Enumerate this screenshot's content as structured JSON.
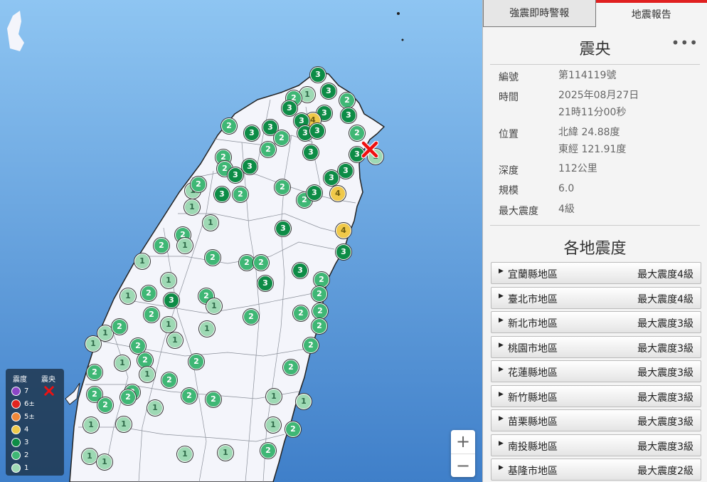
{
  "tabs": [
    {
      "label": "強震即時警報",
      "active": false
    },
    {
      "label": "地震報告",
      "active": true
    }
  ],
  "section_title": "震央",
  "more_label": "•••",
  "info": {
    "number": {
      "label": "編號",
      "value": "第114119號"
    },
    "time": {
      "label": "時間",
      "value_line1": "2025年08月27日",
      "value_line2": "21時11分00秒"
    },
    "location": {
      "label": "位置",
      "value_line1": "北緯 24.88度",
      "value_line2": "東經 121.91度"
    },
    "depth": {
      "label": "深度",
      "value": "112公里"
    },
    "magnitude": {
      "label": "規模",
      "value": "6.0"
    },
    "max_intensity": {
      "label": "最大震度",
      "value": "4級"
    }
  },
  "regions_title": "各地震度",
  "regions": [
    {
      "name": "宜蘭縣地區",
      "max": "最大震度4級"
    },
    {
      "name": "臺北市地區",
      "max": "最大震度4級"
    },
    {
      "name": "新北市地區",
      "max": "最大震度3級"
    },
    {
      "name": "桃園市地區",
      "max": "最大震度3級"
    },
    {
      "name": "花蓮縣地區",
      "max": "最大震度3級"
    },
    {
      "name": "新竹縣地區",
      "max": "最大震度3級"
    },
    {
      "name": "苗栗縣地區",
      "max": "最大震度3級"
    },
    {
      "name": "南投縣地區",
      "max": "最大震度3級"
    },
    {
      "name": "基隆市地區",
      "max": "最大震度2級"
    }
  ],
  "legend": {
    "intensity_header": "震度",
    "epicenter_header": "震央",
    "levels": [
      {
        "label": "7",
        "color": "#8b46c7"
      },
      {
        "label": "6±",
        "color": "#e2241f"
      },
      {
        "label": "5±",
        "color": "#f0883a"
      },
      {
        "label": "4",
        "color": "#f0c94a"
      },
      {
        "label": "3",
        "color": "#0d8c46"
      },
      {
        "label": "2",
        "color": "#3fb775"
      },
      {
        "label": "1",
        "color": "#9ed9b4"
      }
    ]
  },
  "zoom": {
    "in": "+",
    "out": "−"
  },
  "stations": [
    3,
    1,
    3,
    2,
    2,
    3,
    3,
    4,
    3,
    3,
    2,
    3,
    3,
    3,
    2,
    3,
    2,
    3,
    2,
    3,
    1,
    2,
    2,
    3,
    3,
    2,
    3,
    4,
    3,
    2,
    1,
    3,
    4,
    2,
    1,
    2,
    3,
    1,
    2,
    2,
    3,
    3,
    1,
    1,
    2,
    3,
    2,
    3,
    2,
    1,
    2,
    2,
    2,
    3,
    2,
    1,
    2,
    1,
    1,
    2,
    2,
    1,
    1,
    1,
    2,
    2,
    2,
    1,
    2,
    2,
    1,
    2,
    1,
    2,
    2,
    2,
    2,
    2,
    2,
    2,
    2,
    1,
    2,
    2,
    1,
    1,
    1,
    1,
    1,
    2,
    1,
    1,
    1,
    1,
    2
  ],
  "colors": {
    "epicenter": "#ee1111",
    "tab_active_border": "#e02020"
  }
}
